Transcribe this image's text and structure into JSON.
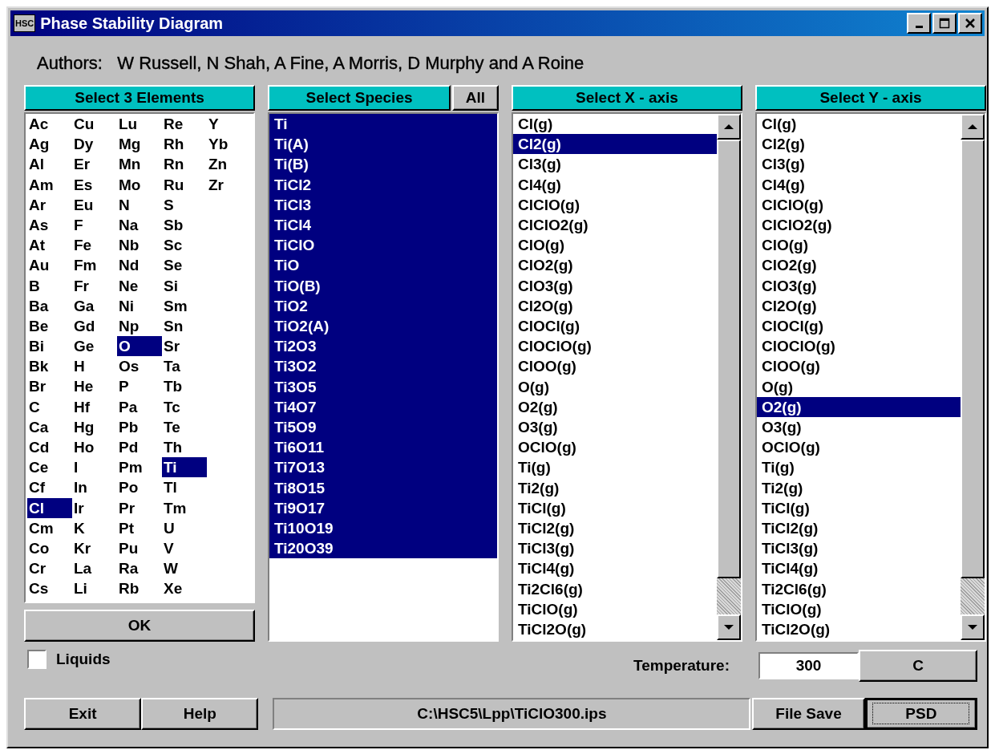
{
  "window": {
    "title": "Phase Stability Diagram",
    "icon_text": "HSC"
  },
  "authors": "Authors:   W Russell, N Shah, A Fine, A Morris, D Murphy and A Roine",
  "elements_panel": {
    "title": "Select 3 Elements",
    "items": [
      {
        "symbol": "Ac",
        "selected": false
      },
      {
        "symbol": "Ag",
        "selected": false
      },
      {
        "symbol": "Al",
        "selected": false
      },
      {
        "symbol": "Am",
        "selected": false
      },
      {
        "symbol": "Ar",
        "selected": false
      },
      {
        "symbol": "As",
        "selected": false
      },
      {
        "symbol": "At",
        "selected": false
      },
      {
        "symbol": "Au",
        "selected": false
      },
      {
        "symbol": "B",
        "selected": false
      },
      {
        "symbol": "Ba",
        "selected": false
      },
      {
        "symbol": "Be",
        "selected": false
      },
      {
        "symbol": "Bi",
        "selected": false
      },
      {
        "symbol": "Bk",
        "selected": false
      },
      {
        "symbol": "Br",
        "selected": false
      },
      {
        "symbol": "C",
        "selected": false
      },
      {
        "symbol": "Ca",
        "selected": false
      },
      {
        "symbol": "Cd",
        "selected": false
      },
      {
        "symbol": "Ce",
        "selected": false
      },
      {
        "symbol": "Cf",
        "selected": false
      },
      {
        "symbol": "Cl",
        "selected": true
      },
      {
        "symbol": "Cm",
        "selected": false
      },
      {
        "symbol": "Co",
        "selected": false
      },
      {
        "symbol": "Cr",
        "selected": false
      },
      {
        "symbol": "Cs",
        "selected": false
      },
      {
        "symbol": "Cu",
        "selected": false
      },
      {
        "symbol": "Dy",
        "selected": false
      },
      {
        "symbol": "Er",
        "selected": false
      },
      {
        "symbol": "Es",
        "selected": false
      },
      {
        "symbol": "Eu",
        "selected": false
      },
      {
        "symbol": "F",
        "selected": false
      },
      {
        "symbol": "Fe",
        "selected": false
      },
      {
        "symbol": "Fm",
        "selected": false
      },
      {
        "symbol": "Fr",
        "selected": false
      },
      {
        "symbol": "Ga",
        "selected": false
      },
      {
        "symbol": "Gd",
        "selected": false
      },
      {
        "symbol": "Ge",
        "selected": false
      },
      {
        "symbol": "H",
        "selected": false
      },
      {
        "symbol": "He",
        "selected": false
      },
      {
        "symbol": "Hf",
        "selected": false
      },
      {
        "symbol": "Hg",
        "selected": false
      },
      {
        "symbol": "Ho",
        "selected": false
      },
      {
        "symbol": "I",
        "selected": false
      },
      {
        "symbol": "In",
        "selected": false
      },
      {
        "symbol": "Ir",
        "selected": false
      },
      {
        "symbol": "K",
        "selected": false
      },
      {
        "symbol": "Kr",
        "selected": false
      },
      {
        "symbol": "La",
        "selected": false
      },
      {
        "symbol": "Li",
        "selected": false
      },
      {
        "symbol": "Lu",
        "selected": false
      },
      {
        "symbol": "Mg",
        "selected": false
      },
      {
        "symbol": "Mn",
        "selected": false
      },
      {
        "symbol": "Mo",
        "selected": false
      },
      {
        "symbol": "N",
        "selected": false
      },
      {
        "symbol": "Na",
        "selected": false
      },
      {
        "symbol": "Nb",
        "selected": false
      },
      {
        "symbol": "Nd",
        "selected": false
      },
      {
        "symbol": "Ne",
        "selected": false
      },
      {
        "symbol": "Ni",
        "selected": false
      },
      {
        "symbol": "Np",
        "selected": false
      },
      {
        "symbol": "O",
        "selected": true
      },
      {
        "symbol": "Os",
        "selected": false
      },
      {
        "symbol": "P",
        "selected": false
      },
      {
        "symbol": "Pa",
        "selected": false
      },
      {
        "symbol": "Pb",
        "selected": false
      },
      {
        "symbol": "Pd",
        "selected": false
      },
      {
        "symbol": "Pm",
        "selected": false
      },
      {
        "symbol": "Po",
        "selected": false
      },
      {
        "symbol": "Pr",
        "selected": false
      },
      {
        "symbol": "Pt",
        "selected": false
      },
      {
        "symbol": "Pu",
        "selected": false
      },
      {
        "symbol": "Ra",
        "selected": false
      },
      {
        "symbol": "Rb",
        "selected": false
      },
      {
        "symbol": "Re",
        "selected": false
      },
      {
        "symbol": "Rh",
        "selected": false
      },
      {
        "symbol": "Rn",
        "selected": false
      },
      {
        "symbol": "Ru",
        "selected": false
      },
      {
        "symbol": "S",
        "selected": false
      },
      {
        "symbol": "Sb",
        "selected": false
      },
      {
        "symbol": "Sc",
        "selected": false
      },
      {
        "symbol": "Se",
        "selected": false
      },
      {
        "symbol": "Si",
        "selected": false
      },
      {
        "symbol": "Sm",
        "selected": false
      },
      {
        "symbol": "Sn",
        "selected": false
      },
      {
        "symbol": "Sr",
        "selected": false
      },
      {
        "symbol": "Ta",
        "selected": false
      },
      {
        "symbol": "Tb",
        "selected": false
      },
      {
        "symbol": "Tc",
        "selected": false
      },
      {
        "symbol": "Te",
        "selected": false
      },
      {
        "symbol": "Th",
        "selected": false
      },
      {
        "symbol": "Ti",
        "selected": true
      },
      {
        "symbol": "Tl",
        "selected": false
      },
      {
        "symbol": "Tm",
        "selected": false
      },
      {
        "symbol": "U",
        "selected": false
      },
      {
        "symbol": "V",
        "selected": false
      },
      {
        "symbol": "W",
        "selected": false
      },
      {
        "symbol": "Xe",
        "selected": false
      },
      {
        "symbol": "Y",
        "selected": false
      },
      {
        "symbol": "Yb",
        "selected": false
      },
      {
        "symbol": "Zn",
        "selected": false
      },
      {
        "symbol": "Zr",
        "selected": false
      }
    ],
    "ok_button": "OK"
  },
  "species_panel": {
    "title": "Select Species",
    "all_button": "All",
    "items": [
      {
        "label": "Ti",
        "selected": true
      },
      {
        "label": "Ti(A)",
        "selected": true
      },
      {
        "label": "Ti(B)",
        "selected": true
      },
      {
        "label": "TiCl2",
        "selected": true
      },
      {
        "label": "TiCl3",
        "selected": true
      },
      {
        "label": "TiCl4",
        "selected": true
      },
      {
        "label": "TiClO",
        "selected": true
      },
      {
        "label": "TiO",
        "selected": true
      },
      {
        "label": "TiO(B)",
        "selected": true
      },
      {
        "label": "TiO2",
        "selected": true
      },
      {
        "label": "TiO2(A)",
        "selected": true
      },
      {
        "label": "Ti2O3",
        "selected": true
      },
      {
        "label": "Ti3O2",
        "selected": true
      },
      {
        "label": "Ti3O5",
        "selected": true
      },
      {
        "label": "Ti4O7",
        "selected": true
      },
      {
        "label": "Ti5O9",
        "selected": true
      },
      {
        "label": "Ti6O11",
        "selected": true
      },
      {
        "label": "Ti7O13",
        "selected": true
      },
      {
        "label": "Ti8O15",
        "selected": true
      },
      {
        "label": "Ti9O17",
        "selected": true
      },
      {
        "label": "Ti10O19",
        "selected": true
      },
      {
        "label": "Ti20O39",
        "selected": true
      }
    ]
  },
  "x_axis_panel": {
    "title": "Select X - axis",
    "items": [
      {
        "label": "Cl(g)",
        "selected": false
      },
      {
        "label": "Cl2(g)",
        "selected": true
      },
      {
        "label": "Cl3(g)",
        "selected": false
      },
      {
        "label": "Cl4(g)",
        "selected": false
      },
      {
        "label": "ClClO(g)",
        "selected": false
      },
      {
        "label": "ClClO2(g)",
        "selected": false
      },
      {
        "label": "ClO(g)",
        "selected": false
      },
      {
        "label": "ClO2(g)",
        "selected": false
      },
      {
        "label": "ClO3(g)",
        "selected": false
      },
      {
        "label": "Cl2O(g)",
        "selected": false
      },
      {
        "label": "ClOCl(g)",
        "selected": false
      },
      {
        "label": "ClOClO(g)",
        "selected": false
      },
      {
        "label": "ClOO(g)",
        "selected": false
      },
      {
        "label": "O(g)",
        "selected": false
      },
      {
        "label": "O2(g)",
        "selected": false
      },
      {
        "label": "O3(g)",
        "selected": false
      },
      {
        "label": "OClO(g)",
        "selected": false
      },
      {
        "label": "Ti(g)",
        "selected": false
      },
      {
        "label": "Ti2(g)",
        "selected": false
      },
      {
        "label": "TiCl(g)",
        "selected": false
      },
      {
        "label": "TiCl2(g)",
        "selected": false
      },
      {
        "label": "TiCl3(g)",
        "selected": false
      },
      {
        "label": "TiCl4(g)",
        "selected": false
      },
      {
        "label": "Ti2Cl6(g)",
        "selected": false
      },
      {
        "label": "TiClO(g)",
        "selected": false
      },
      {
        "label": "TiCl2O(g)",
        "selected": false
      }
    ]
  },
  "y_axis_panel": {
    "title": "Select Y - axis",
    "items": [
      {
        "label": "Cl(g)",
        "selected": false
      },
      {
        "label": "Cl2(g)",
        "selected": false
      },
      {
        "label": "Cl3(g)",
        "selected": false
      },
      {
        "label": "Cl4(g)",
        "selected": false
      },
      {
        "label": "ClClO(g)",
        "selected": false
      },
      {
        "label": "ClClO2(g)",
        "selected": false
      },
      {
        "label": "ClO(g)",
        "selected": false
      },
      {
        "label": "ClO2(g)",
        "selected": false
      },
      {
        "label": "ClO3(g)",
        "selected": false
      },
      {
        "label": "Cl2O(g)",
        "selected": false
      },
      {
        "label": "ClOCl(g)",
        "selected": false
      },
      {
        "label": "ClOClO(g)",
        "selected": false
      },
      {
        "label": "ClOO(g)",
        "selected": false
      },
      {
        "label": "O(g)",
        "selected": false
      },
      {
        "label": "O2(g)",
        "selected": true
      },
      {
        "label": "O3(g)",
        "selected": false
      },
      {
        "label": "OClO(g)",
        "selected": false
      },
      {
        "label": "Ti(g)",
        "selected": false
      },
      {
        "label": "Ti2(g)",
        "selected": false
      },
      {
        "label": "TiCl(g)",
        "selected": false
      },
      {
        "label": "TiCl2(g)",
        "selected": false
      },
      {
        "label": "TiCl3(g)",
        "selected": false
      },
      {
        "label": "TiCl4(g)",
        "selected": false
      },
      {
        "label": "Ti2Cl6(g)",
        "selected": false
      },
      {
        "label": "TiClO(g)",
        "selected": false
      },
      {
        "label": "TiCl2O(g)",
        "selected": false
      }
    ]
  },
  "liquids": {
    "label": "Liquids",
    "checked": false
  },
  "temperature": {
    "label": "Temperature:",
    "value": "300",
    "unit_button": "C"
  },
  "buttons": {
    "exit": "Exit",
    "help": "Help",
    "file_save": "File Save",
    "psd": "PSD"
  },
  "file_path": "C:\\HSC5\\Lpp\\TiClO300.ips"
}
